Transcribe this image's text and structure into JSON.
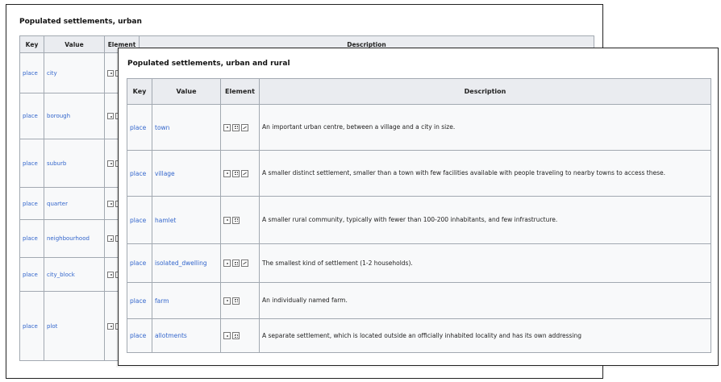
{
  "back_panel": {
    "title": "Populated settlements, urban",
    "headers": {
      "key": "Key",
      "value": "Value",
      "element": "Element",
      "description": "Description"
    },
    "rows": [
      {
        "key": "place",
        "value": "city"
      },
      {
        "key": "place",
        "value": "borough"
      },
      {
        "key": "place",
        "value": "suburb"
      },
      {
        "key": "place",
        "value": "quarter"
      },
      {
        "key": "place",
        "value": "neighbourhood"
      },
      {
        "key": "place",
        "value": "city_block"
      },
      {
        "key": "place",
        "value": "plot"
      }
    ]
  },
  "front_panel": {
    "title": "Populated settlements, urban and rural",
    "headers": {
      "key": "Key",
      "value": "Value",
      "element": "Element",
      "description": "Description"
    },
    "rows": [
      {
        "key": "place",
        "value": "town",
        "description": "An important urban centre, between a village and a city in size."
      },
      {
        "key": "place",
        "value": "village",
        "description": "A smaller distinct settlement, smaller than a town with few facilities available with people traveling to nearby towns to access these."
      },
      {
        "key": "place",
        "value": "hamlet",
        "description": "A smaller rural community, typically with fewer than 100-200 inhabitants, and few infrastructure."
      },
      {
        "key": "place",
        "value": "isolated_dwelling",
        "description": "The smallest kind of settlement (1-2 households)."
      },
      {
        "key": "place",
        "value": "farm",
        "description": "An individually named farm."
      },
      {
        "key": "place",
        "value": "allotments",
        "description": "A separate settlement, which is located outside an officially inhabited locality and has its own addressing"
      }
    ]
  },
  "element_icons": [
    "node-icon",
    "area-icon",
    "way-icon"
  ],
  "colors": {
    "link": "#3366cc",
    "header_bg": "#eaecf0",
    "cell_bg": "#f8f9fa",
    "border": "#a2a9b1"
  }
}
